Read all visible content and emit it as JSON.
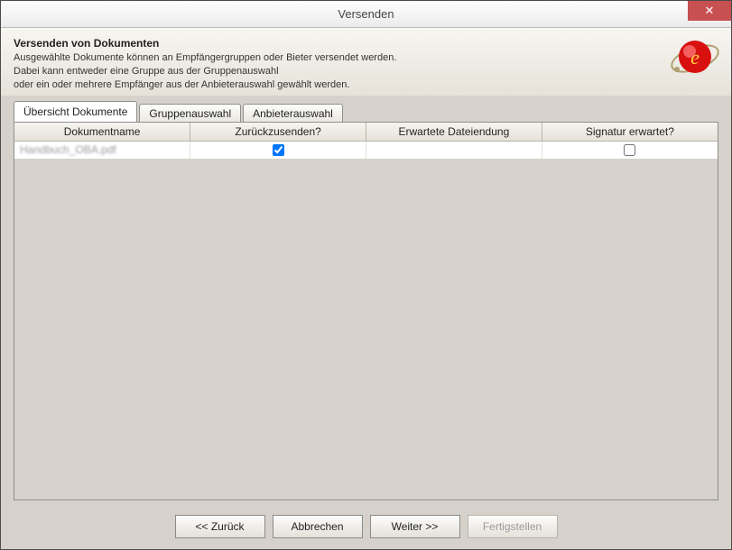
{
  "window": {
    "title": "Versenden",
    "close_glyph": "✕"
  },
  "header": {
    "title": "Versenden von Dokumenten",
    "line1": "Ausgewählte Dokumente können an Empfängergruppen oder Bieter versendet werden.",
    "line2": "Dabei kann entweder eine Gruppe aus der Gruppenauswahl",
    "line3": "oder ein oder mehrere Empfänger aus der Anbieterauswahl gewählt werden."
  },
  "tabs": [
    {
      "label": "Übersicht Dokumente",
      "active": true
    },
    {
      "label": "Gruppenauswahl",
      "active": false
    },
    {
      "label": "Anbieterauswahl",
      "active": false
    }
  ],
  "table": {
    "columns": [
      "Dokumentname",
      "Zurückzusenden?",
      "Erwartete Dateiendung",
      "Signatur erwartet?"
    ],
    "rows": [
      {
        "name": "Handbuch_OBA.pdf",
        "return": true,
        "extension": "",
        "signature": false
      }
    ]
  },
  "buttons": {
    "back": "<< Zurück",
    "cancel": "Abbrechen",
    "next": "Weiter >>",
    "finish": "Fertigstellen"
  }
}
